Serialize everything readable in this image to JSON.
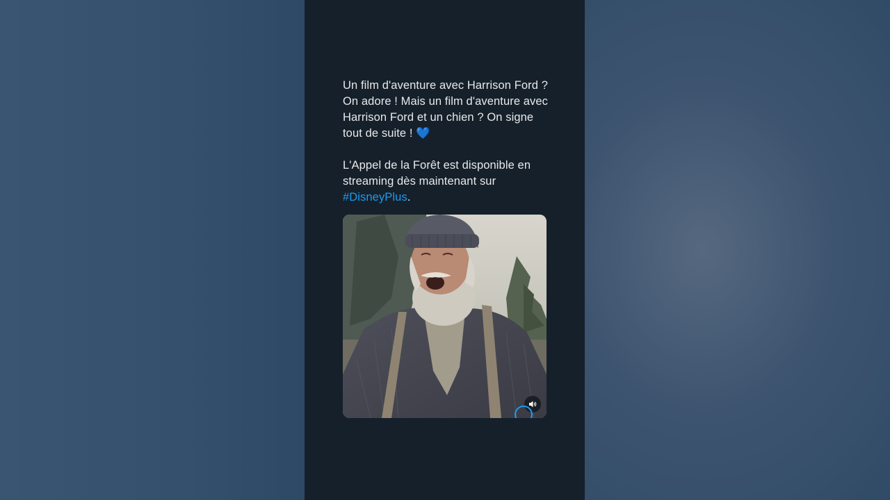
{
  "tweet": {
    "paragraph1": "Un film d'aventure avec Harrison Ford ? On adore ! Mais un film d'aventure avec Harrison Ford et un chien ? On signe tout de suite ! ",
    "heart_emoji": "💙",
    "paragraph2_pre": "L'Appel de la Forêt est disponible en streaming dès maintenant sur ",
    "hashtag": "#DisneyPlus",
    "paragraph2_post": "."
  },
  "media": {
    "type": "video",
    "volume_icon": "speaker-icon",
    "progress_icon": "progress-ring-icon"
  },
  "colors": {
    "panel_bg": "#16202a",
    "text": "#e7e9ea",
    "hashtag": "#1d9bf0",
    "heart": "#3b8fe8"
  }
}
